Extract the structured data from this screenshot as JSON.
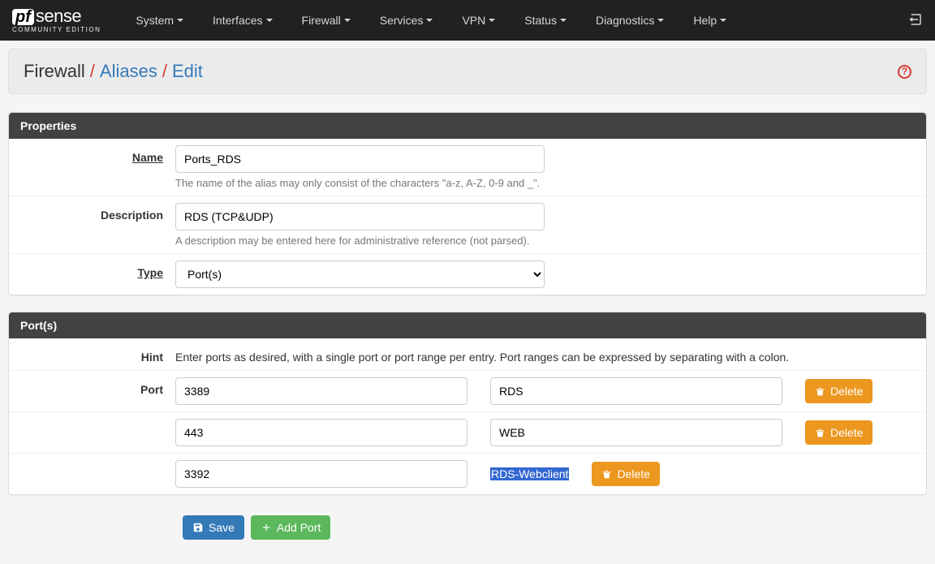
{
  "brand": {
    "pf": "pf",
    "sense": "sense",
    "ce": "COMMUNITY EDITION"
  },
  "nav": {
    "items": [
      "System",
      "Interfaces",
      "Firewall",
      "Services",
      "VPN",
      "Status",
      "Diagnostics",
      "Help"
    ]
  },
  "breadcrumb": {
    "a": "Firewall",
    "b": "Aliases",
    "c": "Edit"
  },
  "properties": {
    "title": "Properties",
    "name_label": "Name",
    "name_value": "Ports_RDS",
    "name_help": "The name of the alias may only consist of the characters \"a-z, A-Z, 0-9 and _\".",
    "desc_label": "Description",
    "desc_value": "RDS (TCP&UDP)",
    "desc_help": "A description may be entered here for administrative reference (not parsed).",
    "type_label": "Type",
    "type_value": "Port(s)"
  },
  "ports": {
    "title": "Port(s)",
    "hint_label": "Hint",
    "hint_text": "Enter ports as desired, with a single port or port range per entry. Port ranges can be expressed by separating with a colon.",
    "port_label": "Port",
    "delete_label": "Delete",
    "rows": [
      {
        "port": "3389",
        "desc": "RDS"
      },
      {
        "port": "443",
        "desc": "WEB"
      },
      {
        "port": "3392",
        "desc": "RDS-Webclient",
        "focused": true
      }
    ]
  },
  "actions": {
    "save": "Save",
    "add": "Add Port"
  }
}
